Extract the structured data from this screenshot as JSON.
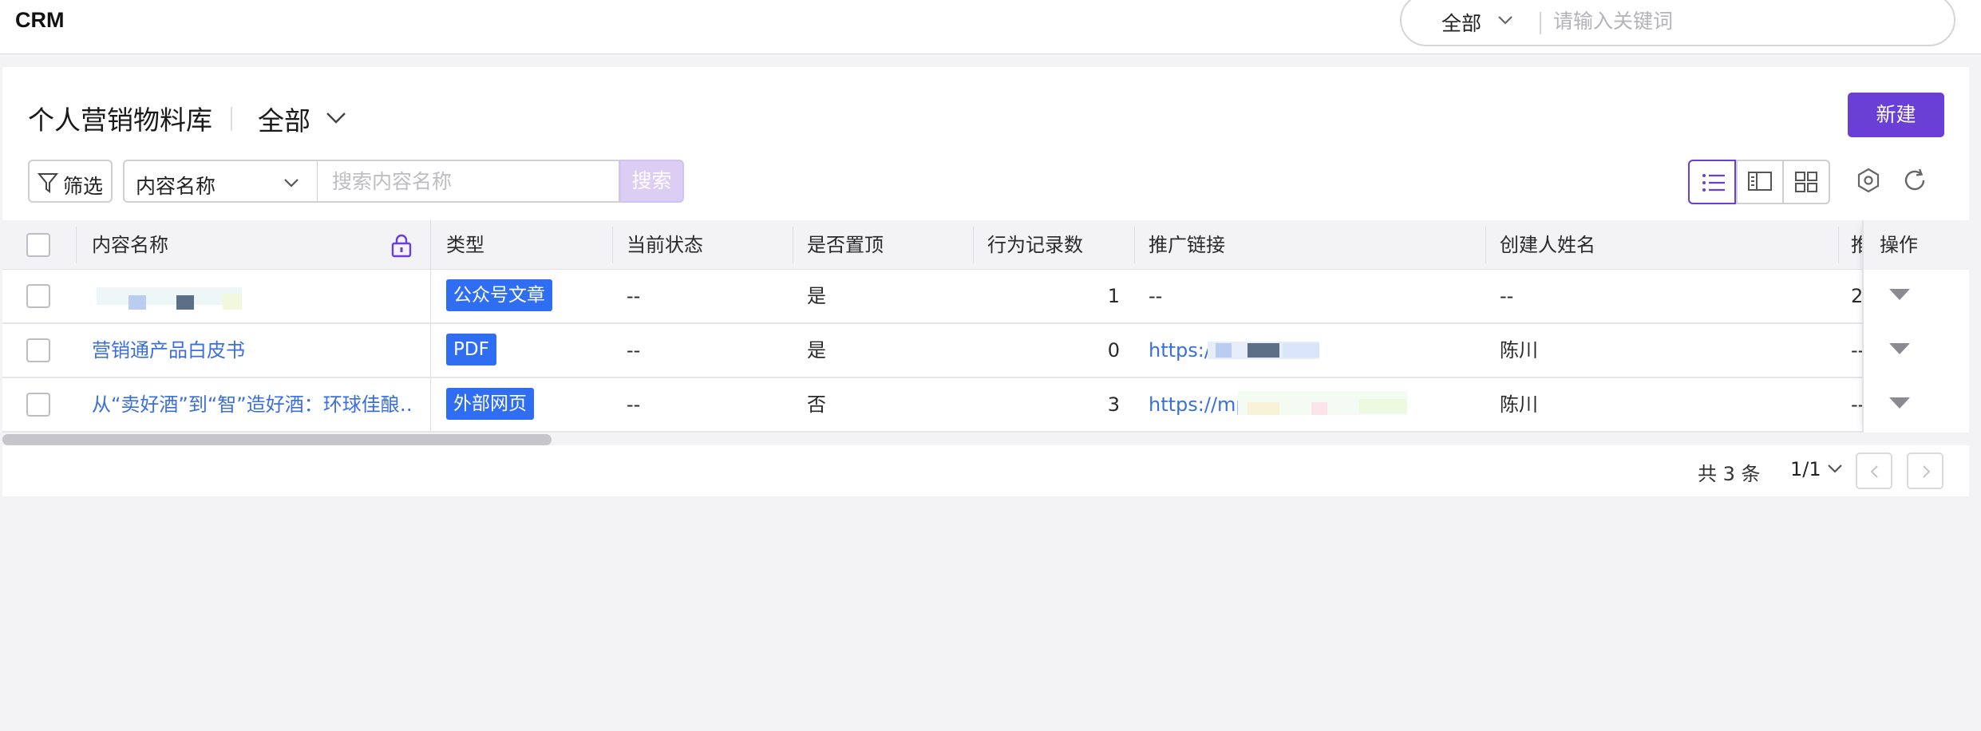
{
  "app": {
    "title": "CRM"
  },
  "global_search": {
    "scope": "全部",
    "placeholder": "请输入关键词"
  },
  "page": {
    "title": "个人营销物料库",
    "view_scope": "全部",
    "new_button": "新建"
  },
  "filter_bar": {
    "filter_button": "筛选",
    "field_select": "内容名称",
    "search_placeholder": "搜索内容名称",
    "search_button": "搜索"
  },
  "icons": {
    "lock": "lock-icon",
    "filter": "funnel-icon",
    "list_view": "list-view-icon",
    "split_view": "split-view-icon",
    "grid_view": "grid-view-icon",
    "settings": "settings-icon",
    "refresh": "refresh-icon"
  },
  "colors": {
    "accent": "#6a3fd5",
    "tag": "#2f6ef2",
    "link": "#3a6fe0"
  },
  "table": {
    "columns": [
      "内容名称",
      "类型",
      "当前状态",
      "是否置顶",
      "行为记录数",
      "推广链接",
      "创建人姓名",
      "推",
      "操作"
    ],
    "rows": [
      {
        "name": "",
        "type": "公众号文章",
        "status": "--",
        "pinned": "是",
        "records": "1",
        "link": "--",
        "creator": "--",
        "extra": "2"
      },
      {
        "name": "营销通产品白皮书",
        "type": "PDF",
        "status": "--",
        "pinned": "是",
        "records": "0",
        "link": "https:/                  b0",
        "creator": "陈川",
        "extra": "--"
      },
      {
        "name": "从“卖好酒”到“智”造好酒：环球佳酿…",
        "type": "外部网页",
        "status": "--",
        "pinned": "否",
        "records": "3",
        "link": "https://mp.                          Jah…",
        "creator": "陈川",
        "extra": "--"
      }
    ]
  },
  "pagination": {
    "total": "共 3 条",
    "page": "1/1"
  }
}
